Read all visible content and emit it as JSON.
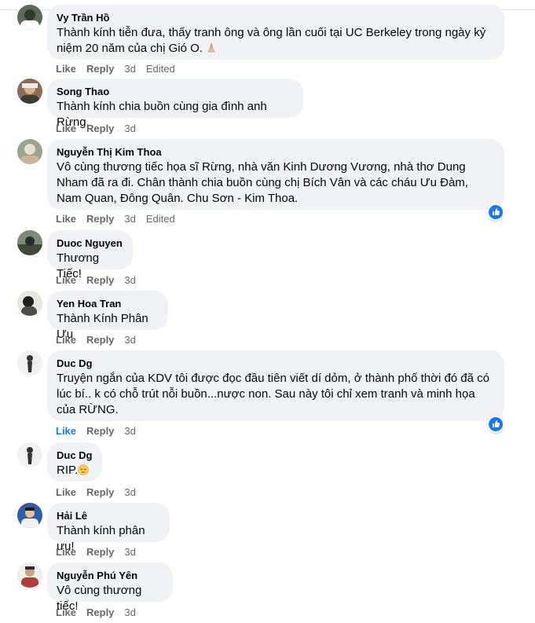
{
  "comments": [
    {
      "name": "Vy Trần Hồ",
      "text": "Thành kính tiễn đưa, thấy tranh ông và ông lần cuối tại UC Berkeley trong ngày kỷ niệm 20 năm của chị Gió O.",
      "like": "Like",
      "reply": "Reply",
      "time": "3d",
      "edited": "Edited",
      "emoji": "folded-hands"
    },
    {
      "name": "Song Thao",
      "text": "Thành kính chia buồn cùng gia đình anh Rừng.",
      "like": "Like",
      "reply": "Reply",
      "time": "3d"
    },
    {
      "name": "Nguyễn Thị Kim Thoa",
      "text": "Vô cùng thương tiếc họa sĩ Rừng, nhà văn Kinh Dương Vương, nhà thơ Dung Nham đã ra đi. Chân thành chia buồn cùng chị Bích Vân và các cháu Ưu Đàm, Nam Quan, Đông Quân. Chu Sơn - Kim Thoa.",
      "like": "Like",
      "reply": "Reply",
      "time": "3d",
      "edited": "Edited",
      "reaction": "like-reaction-icon"
    },
    {
      "name": "Duoc Nguyen",
      "text": "Thương Tiếc!",
      "like": "Like",
      "reply": "Reply",
      "time": "3d"
    },
    {
      "name": "Yen Hoa Tran",
      "text": "Thành Kính Phân Ưu",
      "like": "Like",
      "reply": "Reply",
      "time": "3d"
    },
    {
      "name": "Duc Dg",
      "text": "Truyện ngắn của KDV tôi được đọc đầu tiên viết dí dỏm, ở thành phố thời đó đã có lúc bí.. k có chỗ trút nỗi buồn...nược non. Sau này tôi chỉ xem tranh và minh họa của RỪNG.",
      "like": "Like",
      "reply": "Reply",
      "time": "3d",
      "reaction": "like-reaction-icon",
      "liked": true
    },
    {
      "name": "Duc Dg",
      "text": "RIP.",
      "like": "Like",
      "reply": "Reply",
      "time": "3d",
      "emoji": "relieved-face"
    },
    {
      "name": "Hải Lê",
      "text": "Thành kính phân ưu!",
      "like": "Like",
      "reply": "Reply",
      "time": "3d"
    },
    {
      "name": "Nguyễn Phú Yên",
      "text": "Vô cùng thương tiếc!",
      "like": "Like",
      "reply": "Reply",
      "time": "3d"
    }
  ],
  "colors": {
    "like_active": "#1877f2",
    "bubble": "#f0f2f5",
    "meta": "#65676b"
  }
}
